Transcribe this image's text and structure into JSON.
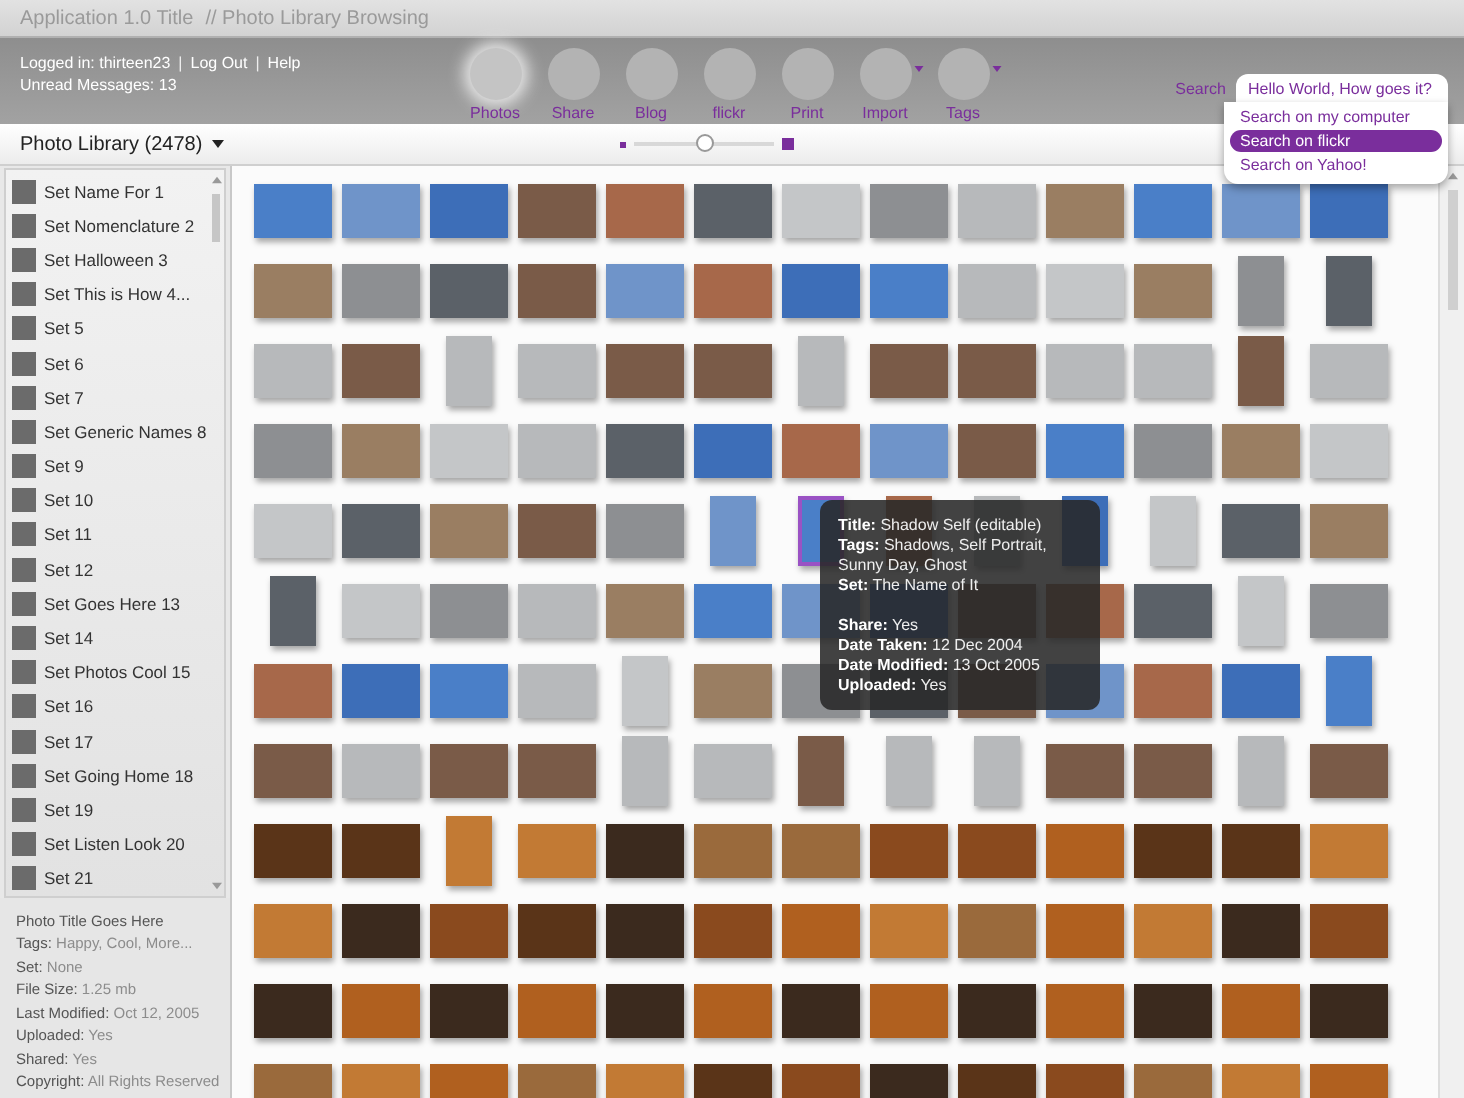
{
  "window": {
    "title": "Application 1.0 Title",
    "subtitle": "// Photo Library Browsing"
  },
  "account": {
    "logged_in": "Logged in: thirteen23",
    "separator": "|",
    "links": [
      "Log Out",
      "Help"
    ],
    "unread": "Unread Messages: 13"
  },
  "nav": [
    {
      "label": "Photos",
      "selected": true,
      "has_menu": false
    },
    {
      "label": "Share",
      "selected": false,
      "has_menu": false
    },
    {
      "label": "Blog",
      "selected": false,
      "has_menu": false
    },
    {
      "label": "flickr",
      "selected": false,
      "has_menu": false
    },
    {
      "label": "Print",
      "selected": false,
      "has_menu": false
    },
    {
      "label": "Import",
      "selected": false,
      "has_menu": true
    },
    {
      "label": "Tags",
      "selected": false,
      "has_menu": true
    }
  ],
  "search": {
    "label": "Search",
    "value": "Hello World, How goes it?",
    "menu": [
      {
        "label": "Search on my computer",
        "selected": false
      },
      {
        "label": "Search on flickr",
        "selected": true
      },
      {
        "label": "Search on Yahoo!",
        "selected": false
      }
    ]
  },
  "toolbar": {
    "library": "Photo Library (2478)",
    "zoom": {
      "level": 0.5
    }
  },
  "sets": [
    {
      "label": "Set Name For 1"
    },
    {
      "label": "Set Nomenclature 2"
    },
    {
      "label": "Set Halloween 3"
    },
    {
      "label": "Set  This is How 4..."
    },
    {
      "label": "Set 5"
    },
    {
      "label": "Set 6"
    },
    {
      "label": "Set 7"
    },
    {
      "label": "Set Generic Names 8"
    },
    {
      "label": "Set 9"
    },
    {
      "label": "Set 10"
    },
    {
      "label": "Set 11"
    },
    {
      "label": "Set 12"
    },
    {
      "label": "Set Goes Here 13"
    },
    {
      "label": "Set 14"
    },
    {
      "label": "Set Photos Cool 15"
    },
    {
      "label": "Set 16"
    },
    {
      "label": "Set 17"
    },
    {
      "label": "Set Going Home 18"
    },
    {
      "label": "Set 19"
    },
    {
      "label": "Set Listen Look 20"
    },
    {
      "label": "Set 21"
    }
  ],
  "info": {
    "title": "Photo Title Goes Here",
    "lines": [
      "**Tags:** Happy, Cool, More...",
      "**Set:** None",
      "**File Size:** 1.25 mb",
      "**Last Modified:** Oct 12, 2005",
      "**Uploaded:** Yes",
      "**Shared:** Yes",
      "**Copyright:** All Rights Reserved"
    ]
  },
  "photo_rows": [
    [
      {
        "kind": "wide",
        "selected": false
      },
      {
        "kind": "wide",
        "selected": false
      },
      {
        "kind": "wide",
        "selected": false
      },
      {
        "kind": "wide",
        "selected": false
      },
      {
        "kind": "wide",
        "selected": false
      },
      {
        "kind": "wide",
        "selected": false
      },
      {
        "kind": "wide",
        "selected": false
      },
      {
        "kind": "wide",
        "selected": false
      },
      {
        "kind": "wide",
        "selected": false
      },
      {
        "kind": "wide",
        "selected": false
      },
      {
        "kind": "wide",
        "selected": false
      },
      {
        "kind": "wide",
        "selected": false
      },
      {
        "kind": "wide",
        "selected": false
      }
    ],
    [
      {
        "kind": "wide",
        "selected": false
      },
      {
        "kind": "wide",
        "selected": false
      },
      {
        "kind": "wide",
        "selected": false
      },
      {
        "kind": "wide",
        "selected": false
      },
      {
        "kind": "wide",
        "selected": false
      },
      {
        "kind": "wide",
        "selected": false
      },
      {
        "kind": "wide",
        "selected": false
      },
      {
        "kind": "wide",
        "selected": false
      },
      {
        "kind": "wide",
        "selected": false
      },
      {
        "kind": "wide",
        "selected": false
      },
      {
        "kind": "wide",
        "selected": false
      },
      {
        "kind": "tall",
        "selected": false
      },
      {
        "kind": "tall",
        "selected": false
      }
    ],
    [
      {
        "kind": "wide",
        "selected": false
      },
      {
        "kind": "wide",
        "selected": false
      },
      {
        "kind": "tall",
        "selected": false
      },
      {
        "kind": "wide",
        "selected": false
      },
      {
        "kind": "wide",
        "selected": false
      },
      {
        "kind": "wide",
        "selected": false
      },
      {
        "kind": "tall",
        "selected": false
      },
      {
        "kind": "wide",
        "selected": false
      },
      {
        "kind": "wide",
        "selected": false
      },
      {
        "kind": "wide",
        "selected": false
      },
      {
        "kind": "wide",
        "selected": false
      },
      {
        "kind": "tall",
        "selected": false
      },
      {
        "kind": "wide",
        "selected": false
      }
    ],
    [
      {
        "kind": "wide",
        "selected": false
      },
      {
        "kind": "wide",
        "selected": false
      },
      {
        "kind": "wide",
        "selected": false
      },
      {
        "kind": "wide",
        "selected": false
      },
      {
        "kind": "wide",
        "selected": false
      },
      {
        "kind": "wide",
        "selected": false
      },
      {
        "kind": "wide",
        "selected": false
      },
      {
        "kind": "wide",
        "selected": false
      },
      {
        "kind": "wide",
        "selected": false
      },
      {
        "kind": "wide",
        "selected": false
      },
      {
        "kind": "wide",
        "selected": false
      },
      {
        "kind": "wide",
        "selected": false
      },
      {
        "kind": "wide",
        "selected": false
      }
    ],
    [
      {
        "kind": "wide",
        "selected": false
      },
      {
        "kind": "wide",
        "selected": false
      },
      {
        "kind": "wide",
        "selected": false
      },
      {
        "kind": "wide",
        "selected": false
      },
      {
        "kind": "wide",
        "selected": false
      },
      {
        "kind": "tall",
        "selected": false
      },
      {
        "kind": "tall",
        "selected": true
      },
      {
        "kind": "tall",
        "selected": false
      },
      {
        "kind": "tall",
        "selected": false
      },
      {
        "kind": "tall",
        "selected": false
      },
      {
        "kind": "tall",
        "selected": false
      },
      {
        "kind": "wide",
        "selected": false
      },
      {
        "kind": "wide",
        "selected": false
      }
    ],
    [
      {
        "kind": "tall",
        "selected": false
      },
      {
        "kind": "wide",
        "selected": false
      },
      {
        "kind": "wide",
        "selected": false
      },
      {
        "kind": "wide",
        "selected": false
      },
      {
        "kind": "wide",
        "selected": false
      },
      {
        "kind": "wide",
        "selected": false
      },
      {
        "kind": "wide",
        "selected": false
      },
      {
        "kind": "wide",
        "selected": false
      },
      {
        "kind": "wide",
        "selected": false
      },
      {
        "kind": "wide",
        "selected": false
      },
      {
        "kind": "wide",
        "selected": false
      },
      {
        "kind": "tall",
        "selected": false
      },
      {
        "kind": "wide",
        "selected": false
      }
    ],
    [
      {
        "kind": "wide",
        "selected": false
      },
      {
        "kind": "wide",
        "selected": false
      },
      {
        "kind": "wide",
        "selected": false
      },
      {
        "kind": "wide",
        "selected": false
      },
      {
        "kind": "tall",
        "selected": false
      },
      {
        "kind": "wide",
        "selected": false
      },
      {
        "kind": "wide",
        "selected": false
      },
      {
        "kind": "wide",
        "selected": false
      },
      {
        "kind": "wide",
        "selected": false
      },
      {
        "kind": "wide",
        "selected": false
      },
      {
        "kind": "wide",
        "selected": false
      },
      {
        "kind": "wide",
        "selected": false
      },
      {
        "kind": "tall",
        "selected": false
      }
    ],
    [
      {
        "kind": "wide",
        "selected": false
      },
      {
        "kind": "wide",
        "selected": false
      },
      {
        "kind": "wide",
        "selected": false
      },
      {
        "kind": "wide",
        "selected": false
      },
      {
        "kind": "tall",
        "selected": false
      },
      {
        "kind": "wide",
        "selected": false
      },
      {
        "kind": "tall",
        "selected": false
      },
      {
        "kind": "tall",
        "selected": false
      },
      {
        "kind": "tall",
        "selected": false
      },
      {
        "kind": "wide",
        "selected": false
      },
      {
        "kind": "wide",
        "selected": false
      },
      {
        "kind": "tall",
        "selected": false
      },
      {
        "kind": "wide",
        "selected": false
      }
    ],
    [
      {
        "kind": "wide",
        "selected": false
      },
      {
        "kind": "wide",
        "selected": false
      },
      {
        "kind": "tall",
        "selected": false
      },
      {
        "kind": "wide",
        "selected": false
      },
      {
        "kind": "wide",
        "selected": false
      },
      {
        "kind": "wide",
        "selected": false
      },
      {
        "kind": "wide",
        "selected": false
      },
      {
        "kind": "wide",
        "selected": false
      },
      {
        "kind": "wide",
        "selected": false
      },
      {
        "kind": "wide",
        "selected": false
      },
      {
        "kind": "wide",
        "selected": false
      },
      {
        "kind": "wide",
        "selected": false
      },
      {
        "kind": "wide",
        "selected": false
      }
    ],
    [
      {
        "kind": "wide",
        "selected": false
      },
      {
        "kind": "wide",
        "selected": false
      },
      {
        "kind": "wide",
        "selected": false
      },
      {
        "kind": "wide",
        "selected": false
      },
      {
        "kind": "wide",
        "selected": false
      },
      {
        "kind": "wide",
        "selected": false
      },
      {
        "kind": "wide",
        "selected": false
      },
      {
        "kind": "wide",
        "selected": false
      },
      {
        "kind": "wide",
        "selected": false
      },
      {
        "kind": "wide",
        "selected": false
      },
      {
        "kind": "wide",
        "selected": false
      },
      {
        "kind": "wide",
        "selected": false
      },
      {
        "kind": "wide",
        "selected": false
      }
    ],
    [
      {
        "kind": "wide",
        "selected": false
      },
      {
        "kind": "wide",
        "selected": false
      },
      {
        "kind": "wide",
        "selected": false
      },
      {
        "kind": "wide",
        "selected": false
      },
      {
        "kind": "wide",
        "selected": false
      },
      {
        "kind": "wide",
        "selected": false
      },
      {
        "kind": "wide",
        "selected": false
      },
      {
        "kind": "wide",
        "selected": false
      },
      {
        "kind": "wide",
        "selected": false
      },
      {
        "kind": "wide",
        "selected": false
      },
      {
        "kind": "wide",
        "selected": false
      },
      {
        "kind": "wide",
        "selected": false
      },
      {
        "kind": "wide",
        "selected": false
      }
    ],
    [
      {
        "kind": "wide",
        "selected": false
      },
      {
        "kind": "wide",
        "selected": false
      },
      {
        "kind": "wide",
        "selected": false
      },
      {
        "kind": "wide",
        "selected": false
      },
      {
        "kind": "wide",
        "selected": false
      },
      {
        "kind": "wide",
        "selected": false
      },
      {
        "kind": "wide",
        "selected": false
      },
      {
        "kind": "wide",
        "selected": false
      },
      {
        "kind": "wide",
        "selected": false
      },
      {
        "kind": "wide",
        "selected": false
      },
      {
        "kind": "wide",
        "selected": false
      },
      {
        "kind": "wide",
        "selected": false
      },
      {
        "kind": "wide",
        "selected": false
      }
    ]
  ],
  "tooltip": {
    "groups": [
      [
        "**Title:** Shadow Self (editable)",
        "**Tags:** Shadows, Self Portrait, Sunny Day, Ghost",
        "**Set:** The Name of It"
      ],
      [
        "**Share:** Yes",
        "**Date Taken:** 12 Dec 2004",
        "**Date Modified:** 13 Oct 2005",
        "**Uploaded:** Yes"
      ]
    ]
  }
}
